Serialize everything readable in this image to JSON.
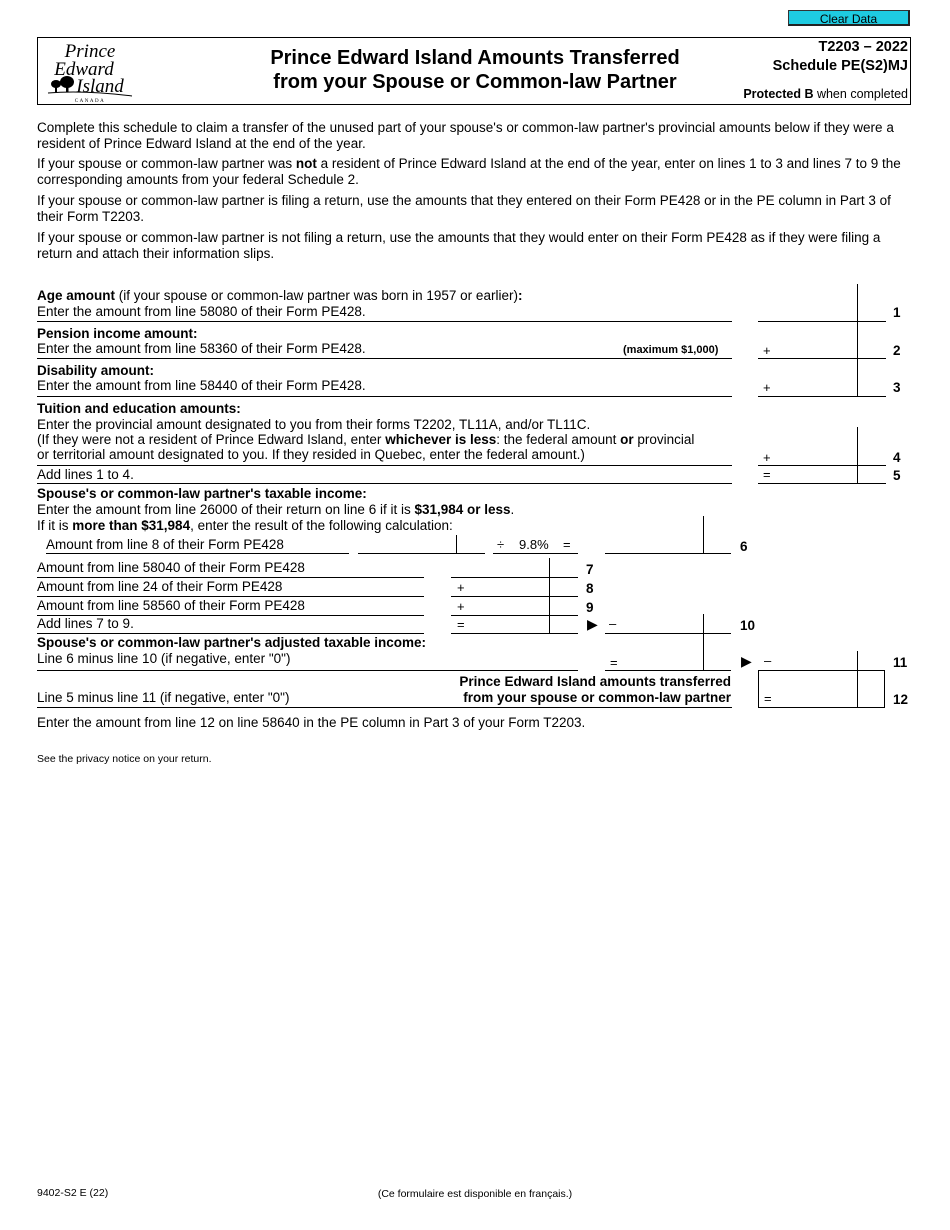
{
  "toolbar": {
    "clear_label": "Clear Data",
    "clear_color": "#1ecbe1"
  },
  "header": {
    "logo": {
      "line1": "Prince",
      "line2": "Edward",
      "line3": "Island",
      "country": "CANADA"
    },
    "title_line1": "Prince Edward Island Amounts Transferred",
    "title_line2": "from your Spouse or Common-law Partner",
    "form_number": "T2203 – 2022",
    "schedule": "Schedule PE(S2)MJ",
    "protected_bold": "Protected B",
    "protected_rest": " when completed"
  },
  "intro": [
    {
      "pre": "Complete this schedule to claim a transfer of the unused part of your spouse's or common-law partner's provincial amounts below if they were a resident of Prince Edward Island at the end of the year.",
      "bold": "",
      "post": ""
    },
    {
      "pre": "If your spouse or common-law partner was ",
      "bold": "not",
      "post": " a resident of Prince Edward Island at the end of the year, enter on lines 1 to 3 and lines 7 to 9 the corresponding amounts from your federal Schedule 2."
    },
    {
      "pre": "If your spouse or common-law partner is filing a return, use the amounts that they entered on their Form PE428 or in the PE column in Part 3 of their Form T2203.",
      "bold": "",
      "post": ""
    },
    {
      "pre": "If your spouse or common-law partner is not filing a return, use the amounts that they would enter on their Form PE428 as if they were filing a return and attach their information slips.",
      "bold": "",
      "post": ""
    }
  ],
  "lines": {
    "l1": {
      "heading": "Age amount",
      "heading_rest": " (if your spouse or common-law partner was born in 1957 or earlier)",
      "colon": ":",
      "text": "Enter the amount from line 58080 of their Form PE428.",
      "num": "1",
      "value": ""
    },
    "l2": {
      "heading": "Pension income amount:",
      "text": "Enter the amount from line 58360 of their Form PE428.",
      "note": "(maximum $1,000)",
      "op": "+",
      "num": "2",
      "value": ""
    },
    "l3": {
      "heading": "Disability amount:",
      "text": "Enter the amount from line 58440 of their Form PE428.",
      "op": "+",
      "num": "3",
      "value": ""
    },
    "l4": {
      "heading": "Tuition and education amounts:",
      "text1": "Enter the provincial amount designated to you from their forms T2202, TL11A, and/or TL11C.",
      "text2_pre": "(If they were not a resident of Prince Edward Island, enter ",
      "text2_bold": "whichever is less",
      "text2_mid": ": the federal amount ",
      "text2_bold2": "or",
      "text2_post": " provincial",
      "text3": "or territorial amount designated to you. If they resided in Quebec, enter the federal amount.)",
      "op": "+",
      "num": "4",
      "value": ""
    },
    "l5": {
      "text": "Add lines 1 to 4.",
      "op": "=",
      "num": "5",
      "value": ""
    },
    "l6": {
      "heading": "Spouse's or common-law partner's taxable income:",
      "text1_pre": "Enter the amount from line 26000 of their return on line 6 if it is ",
      "text1_bold": "$31,984 or less",
      "text1_post": ".",
      "text2_pre": "If it is ",
      "text2_bold": "more than $31,984",
      "text2_post": ", enter the result of the following calculation:",
      "calc_label": "Amount from line 8 of their Form PE428",
      "divide_op": "÷",
      "rate": "9.8%",
      "eq": "=",
      "num": "6",
      "calc_value": "",
      "value": ""
    },
    "l7": {
      "text": "Amount from line 58040 of their Form PE428",
      "num": "7",
      "value": ""
    },
    "l8": {
      "text": "Amount from line 24 of their Form PE428",
      "op": "+",
      "num": "8",
      "value": ""
    },
    "l9": {
      "text": "Amount from line 58560 of their Form PE428",
      "op": "+",
      "num": "9",
      "value": ""
    },
    "l10": {
      "text": "Add lines 7 to 9.",
      "op": "=",
      "arrow": "▶",
      "op2": "–",
      "num": "10",
      "value": "",
      "value2": ""
    },
    "l11": {
      "heading": "Spouse's or common-law partner's adjusted taxable income:",
      "text": "Line 6 minus line 10 (if negative, enter \"0\")",
      "op": "=",
      "arrow": "▶",
      "op2": "–",
      "num": "11",
      "value": "",
      "value2": ""
    },
    "l12": {
      "text": "Line 5 minus line 11 (if negative, enter \"0\")",
      "label1": "Prince Edward Island amounts transferred",
      "label2": "from your spouse or common-law partner",
      "op": "=",
      "num": "12",
      "value": ""
    }
  },
  "instruction": "Enter the amount from line 12 on line 58640 in the PE column in Part 3 of your Form T2203.",
  "privacy": "See the privacy notice on your return.",
  "footer": {
    "form_code": "9402-S2 E (22)",
    "french": "(Ce formulaire est disponible en français.)"
  }
}
